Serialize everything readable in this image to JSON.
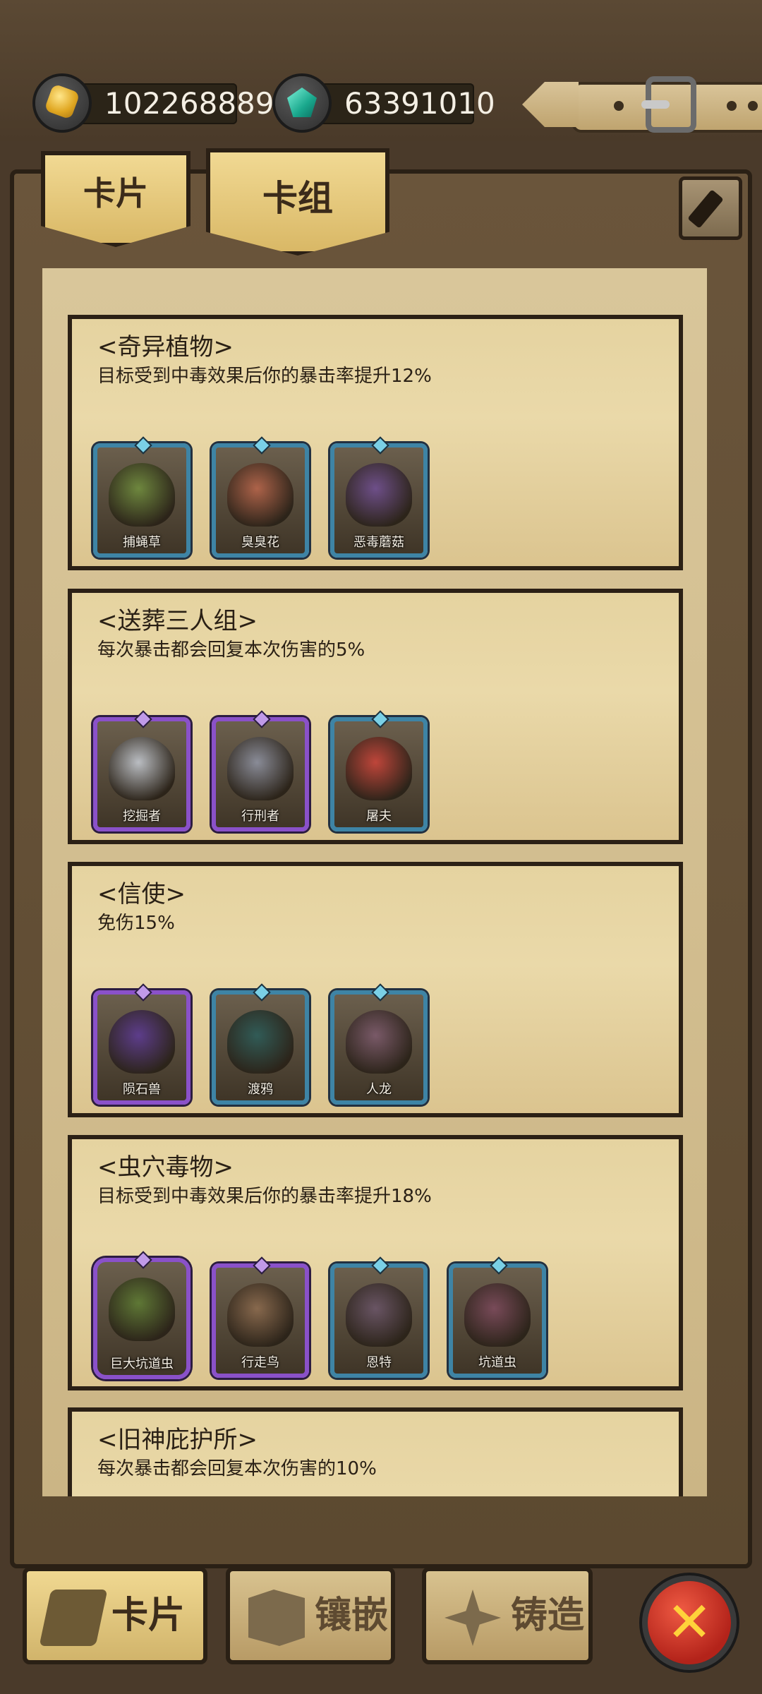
{
  "currencies": {
    "gold": "102268889",
    "gems": "63391010"
  },
  "tabs": {
    "cards": "卡片",
    "decks": "卡组"
  },
  "decks": [
    {
      "title": "<奇异植物>",
      "desc": "目标受到中毒效果后你的暴击率提升12%",
      "cards": [
        {
          "name": "捕蝇草",
          "rarity": "blue",
          "color": "#6f8a3e"
        },
        {
          "name": "臭臭花",
          "rarity": "blue",
          "color": "#b2644a"
        },
        {
          "name": "恶毒蘑菇",
          "rarity": "blue",
          "color": "#6f4f8d"
        }
      ]
    },
    {
      "title": "<送葬三人组>",
      "desc": "每次暴击都会回复本次伤害的5%",
      "cards": [
        {
          "name": "挖掘者",
          "rarity": "purple",
          "color": "#bfc3c9"
        },
        {
          "name": "行刑者",
          "rarity": "purple",
          "color": "#8c8f9c"
        },
        {
          "name": "屠夫",
          "rarity": "blue",
          "color": "#c4453a"
        }
      ]
    },
    {
      "title": "<信使>",
      "desc": "免伤15%",
      "cards": [
        {
          "name": "陨石兽",
          "rarity": "purple",
          "color": "#5d3c8f"
        },
        {
          "name": "渡鸦",
          "rarity": "blue",
          "color": "#2f5c58"
        },
        {
          "name": "人龙",
          "rarity": "blue",
          "color": "#7b5a6a"
        }
      ]
    },
    {
      "title": "<虫穴毒物>",
      "desc": "目标受到中毒效果后你的暴击率提升18%",
      "cards": [
        {
          "name": "巨大坑道虫",
          "rarity": "purple",
          "color": "#5f7a35",
          "big": true
        },
        {
          "name": "行走鸟",
          "rarity": "purple",
          "color": "#8a6a4e"
        },
        {
          "name": "恩特",
          "rarity": "blue",
          "color": "#6a5566"
        },
        {
          "name": "坑道虫",
          "rarity": "blue",
          "color": "#7a4a5a"
        }
      ]
    },
    {
      "title": "<旧神庇护所>",
      "desc": "每次暴击都会回复本次伤害的10%",
      "cards": []
    }
  ],
  "bottom_nav": [
    {
      "label": "卡片",
      "icon": "card-icon",
      "active": true
    },
    {
      "label": "镶嵌",
      "icon": "inlay-icon",
      "active": false
    },
    {
      "label": "铸造",
      "icon": "forge-icon",
      "active": false
    }
  ],
  "close_symbol": "✕"
}
